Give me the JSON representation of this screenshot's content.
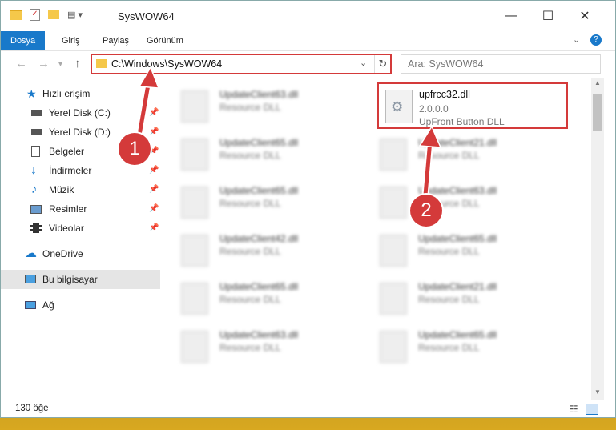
{
  "window": {
    "title": "SysWOW64"
  },
  "ribbon": {
    "tabs": [
      "Dosya",
      "Giriş",
      "Paylaş",
      "Görünüm"
    ]
  },
  "address": {
    "path": "C:\\Windows\\SysWOW64",
    "search_placeholder": "Ara: SysWOW64"
  },
  "sidebar": {
    "items": [
      {
        "label": "Hızlı erişim",
        "icon": "star-icon"
      },
      {
        "label": "Yerel Disk (C:)",
        "icon": "drive-icon",
        "pinned": true
      },
      {
        "label": "Yerel Disk (D:)",
        "icon": "drive-icon",
        "pinned": true
      },
      {
        "label": "Belgeler",
        "icon": "documents-icon",
        "pinned": true
      },
      {
        "label": "İndirmeler",
        "icon": "download-icon",
        "pinned": true
      },
      {
        "label": "Müzik",
        "icon": "music-icon",
        "pinned": true
      },
      {
        "label": "Resimler",
        "icon": "pictures-icon",
        "pinned": true
      },
      {
        "label": "Videolar",
        "icon": "videos-icon",
        "pinned": true
      },
      {
        "label": "OneDrive",
        "icon": "cloud-icon"
      },
      {
        "label": "Bu bilgisayar",
        "icon": "computer-icon",
        "selected": true
      },
      {
        "label": "Ağ",
        "icon": "network-icon"
      }
    ]
  },
  "files": {
    "left": [
      {
        "name": "UpdateClient63.dll",
        "desc": "Resource DLL"
      },
      {
        "name": "UpdateClient65.dll",
        "desc": "Resource DLL"
      },
      {
        "name": "UpdateClient65.dll",
        "desc": "Resource DLL"
      },
      {
        "name": "UpdateClient42.dll",
        "desc": "Resource DLL"
      },
      {
        "name": "UpdateClient65.dll",
        "desc": "Resource DLL"
      },
      {
        "name": "UpdateClient63.dll",
        "desc": "Resource DLL"
      }
    ],
    "right": [
      {
        "name": "UpdateClient21.dll",
        "desc": "Resource DLL"
      },
      {
        "name": "UpdateClient63.dll",
        "desc": "Resource DLL"
      },
      {
        "name": "UpdateClient65.dll",
        "desc": "Resource DLL"
      },
      {
        "name": "UpdateClient21.dll",
        "desc": "Resource DLL"
      },
      {
        "name": "UpdateClient65.dll",
        "desc": "Resource DLL"
      }
    ],
    "highlighted": {
      "name": "upfrcc32.dll",
      "version": "2.0.0.0",
      "desc": "UpFront Button DLL"
    }
  },
  "status": {
    "count": "130 öğe"
  },
  "markers": [
    "1",
    "2"
  ],
  "colors": {
    "accent": "#1979ca",
    "highlight": "#d43a3a",
    "folder": "#f5c84a"
  }
}
